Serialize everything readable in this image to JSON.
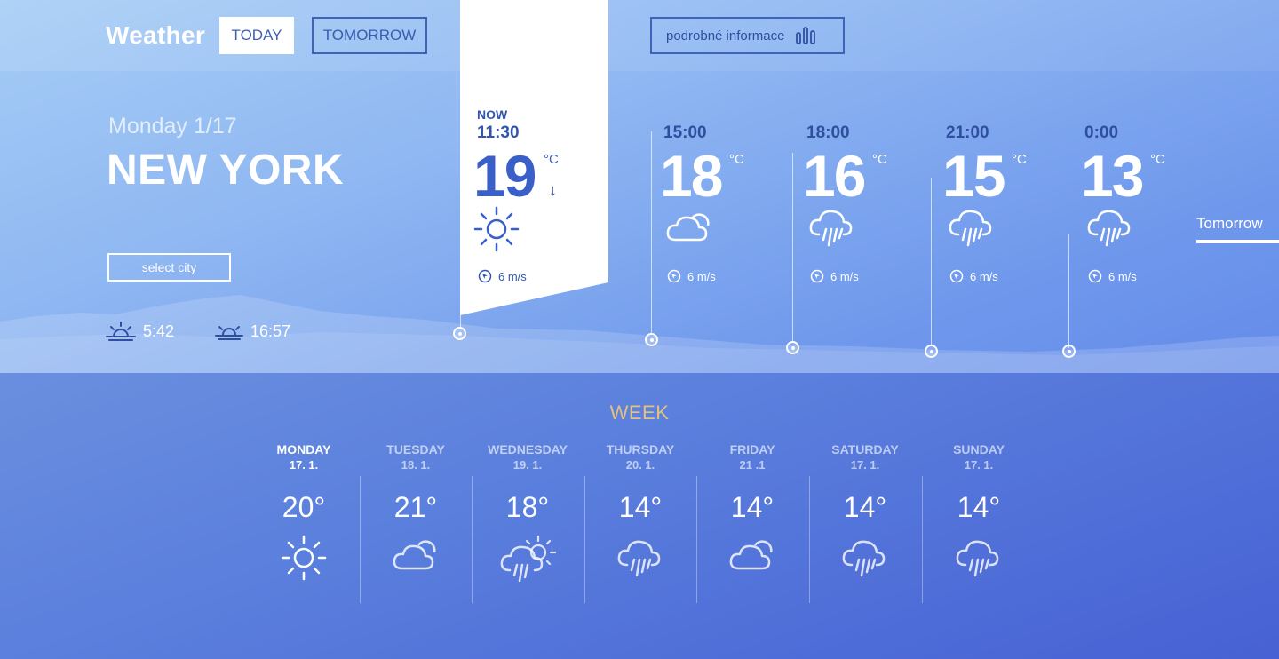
{
  "header": {
    "brand": "Weather",
    "tabs": [
      {
        "label": "TODAY",
        "active": true
      },
      {
        "label": "TOMORROW",
        "active": false
      }
    ],
    "details_label": "podrobné informace",
    "details_icon": "bar-chart-icon"
  },
  "location": {
    "date": "Monday 1/17",
    "city": "NEW YORK",
    "select_city_label": "select city",
    "sunrise": "5:42",
    "sunset": "16:57"
  },
  "now": {
    "label": "NOW",
    "time": "11:30",
    "temp": "19",
    "unit": "°C",
    "trend_arrow": "↓",
    "icon": "sun-icon",
    "wind": "6 m/s"
  },
  "hourly": [
    {
      "time": "15:00",
      "temp": "18",
      "unit": "°C",
      "icon": "partly-cloudy-icon",
      "wind": "6 m/s"
    },
    {
      "time": "18:00",
      "temp": "16",
      "unit": "°C",
      "icon": "rain-icon",
      "wind": "6 m/s"
    },
    {
      "time": "21:00",
      "temp": "15",
      "unit": "°C",
      "icon": "rain-icon",
      "wind": "6 m/s"
    },
    {
      "time": "0:00",
      "temp": "13",
      "unit": "°C",
      "icon": "rain-icon",
      "wind": "6 m/s"
    }
  ],
  "tomorrow_link": "Tomorrow",
  "week": {
    "title": "WEEK",
    "days": [
      {
        "name": "MONDAY",
        "date": "17. 1.",
        "temp": "20°",
        "icon": "sun-icon",
        "active": true
      },
      {
        "name": "TUESDAY",
        "date": "18. 1.",
        "temp": "21°",
        "icon": "cloud-icon",
        "active": false
      },
      {
        "name": "WEDNESDAY",
        "date": "19. 1.",
        "temp": "18°",
        "icon": "sun-rain-icon",
        "active": false
      },
      {
        "name": "THURSDAY",
        "date": "20. 1.",
        "temp": "14°",
        "icon": "rain-icon",
        "active": false
      },
      {
        "name": "FRIDAY",
        "date": "21 .1",
        "temp": "14°",
        "icon": "cloud-icon",
        "active": false
      },
      {
        "name": "SATURDAY",
        "date": "17. 1.",
        "temp": "14°",
        "icon": "rain-icon",
        "active": false
      },
      {
        "name": "SUNDAY",
        "date": "17. 1.",
        "temp": "14°",
        "icon": "rain-icon",
        "active": false
      }
    ]
  },
  "colors": {
    "accent_week": "#e3c27d",
    "card_text": "#3255b0",
    "dark_blue": "#2f4f9e"
  }
}
